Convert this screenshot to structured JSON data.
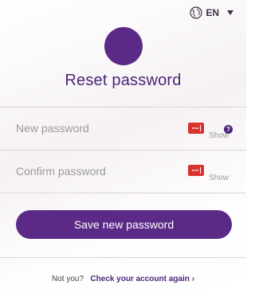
{
  "language": {
    "code": "EN"
  },
  "page": {
    "title": "Reset password"
  },
  "fields": {
    "new_password": {
      "placeholder": "New password",
      "show_label": "Show"
    },
    "confirm_password": {
      "placeholder": "Confirm password",
      "show_label": "Show"
    },
    "help_glyph": "?"
  },
  "actions": {
    "save_label": "Save new password"
  },
  "footer": {
    "prompt": "Not you?",
    "link_label": "Check your account again",
    "link_arrow": "›"
  },
  "colors": {
    "brand_purple": "#5b2a86",
    "title_purple": "#4a2578",
    "password_manager_red": "#d8322c",
    "placeholder_gray": "#9a9a9a",
    "divider": "#d9d4dc"
  },
  "icons": {
    "language": "globe-icon",
    "language_menu": "caret-down-icon",
    "password_manager": "password-manager-icon",
    "help": "help-icon"
  }
}
